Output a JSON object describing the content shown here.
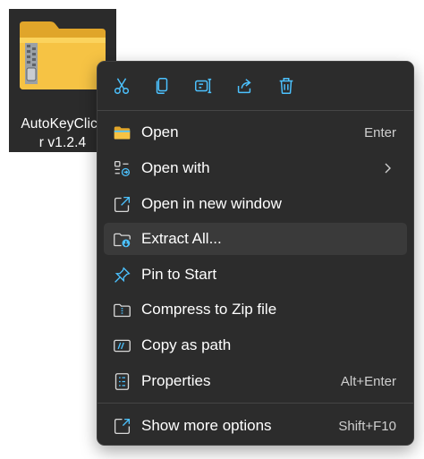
{
  "file": {
    "label": "AutoKeyClicker v1.2.4",
    "label_display": "AutoKeyClick\nr v1.2.4",
    "icon": "zip-folder-icon"
  },
  "quick_actions": [
    {
      "name": "cut",
      "icon": "scissors-icon"
    },
    {
      "name": "copy",
      "icon": "copy-icon"
    },
    {
      "name": "rename",
      "icon": "rename-icon"
    },
    {
      "name": "share",
      "icon": "share-icon"
    },
    {
      "name": "delete",
      "icon": "trash-icon"
    }
  ],
  "menu": {
    "items": [
      {
        "label": "Open",
        "shortcut": "Enter",
        "icon": "folder-icon"
      },
      {
        "label": "Open with",
        "shortcut": "",
        "icon": "open-with-icon",
        "submenu": true
      },
      {
        "label": "Open in new window",
        "shortcut": "",
        "icon": "open-new-window-icon"
      },
      {
        "label": "Extract All...",
        "shortcut": "",
        "icon": "extract-icon",
        "hovered": true
      },
      {
        "label": "Pin to Start",
        "shortcut": "",
        "icon": "pin-icon"
      },
      {
        "label": "Compress to Zip file",
        "shortcut": "",
        "icon": "compress-icon"
      },
      {
        "label": "Copy as path",
        "shortcut": "",
        "icon": "copy-path-icon"
      },
      {
        "label": "Properties",
        "shortcut": "Alt+Enter",
        "icon": "properties-icon"
      }
    ],
    "more": {
      "label": "Show more options",
      "shortcut": "Shift+F10",
      "icon": "show-more-icon"
    }
  },
  "colors": {
    "menu_bg": "#2c2c2c",
    "hover_bg": "#3a3a3a",
    "accent": "#4cc2ff",
    "folder_yellow": "#f6c344",
    "text": "#ffffff"
  }
}
